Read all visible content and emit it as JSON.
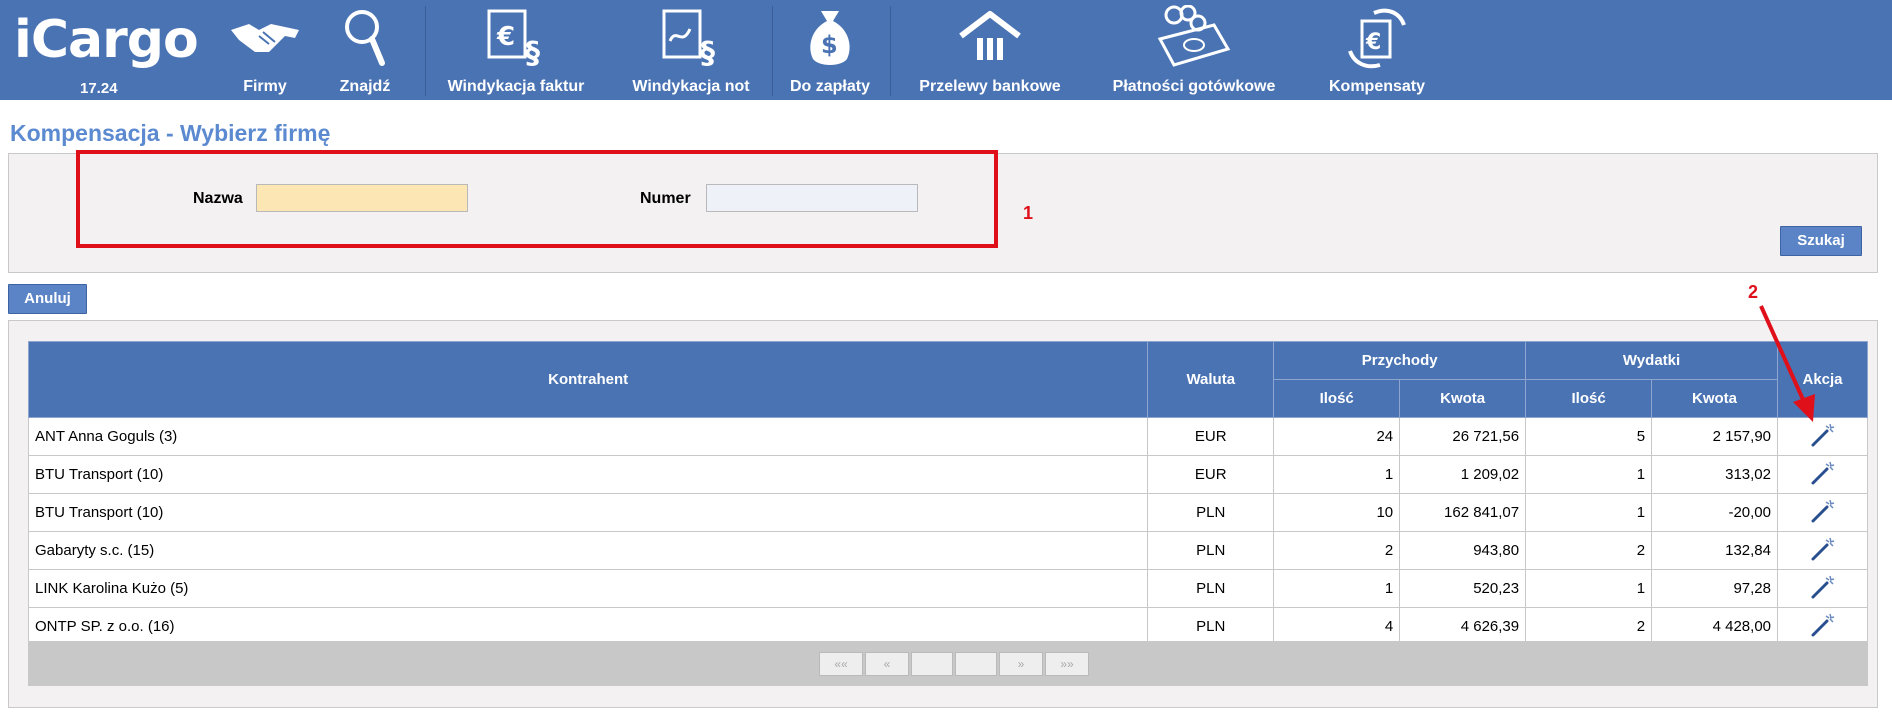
{
  "app": {
    "logo_text": "iCargo",
    "version": "17.24"
  },
  "nav": [
    {
      "label": "Firmy",
      "icon": "handshake-icon"
    },
    {
      "label": "Znajdź",
      "icon": "magnifier-icon"
    },
    {
      "label": "Windykacja faktur",
      "icon": "invoice-euro-icon"
    },
    {
      "label": "Windykacja not",
      "icon": "note-signature-icon"
    },
    {
      "label": "Do zapłaty",
      "icon": "money-bag-icon"
    },
    {
      "label": "Przelewy bankowe",
      "icon": "bank-icon"
    },
    {
      "label": "Płatności gotówkowe",
      "icon": "cash-coins-icon"
    },
    {
      "label": "Kompensaty",
      "icon": "compensation-euro-icon"
    }
  ],
  "page": {
    "title": "Kompensacja - Wybierz firmę"
  },
  "search": {
    "name_label": "Nazwa",
    "name_value": "",
    "number_label": "Numer",
    "number_value": "",
    "search_button": "Szukaj"
  },
  "annotations": {
    "first": "1",
    "second": "2"
  },
  "cancel_button": "Anuluj",
  "table": {
    "headers": {
      "contractor": "Kontrahent",
      "currency": "Waluta",
      "income": "Przychody",
      "expenses": "Wydatki",
      "count": "Ilość",
      "amount": "Kwota",
      "action": "Akcja"
    },
    "rows": [
      {
        "contractor": "ANT Anna Goguls (3)",
        "currency": "EUR",
        "income_count": "24",
        "income_amount": "26 721,56",
        "expense_count": "5",
        "expense_amount": "2 157,90"
      },
      {
        "contractor": "BTU Transport (10)",
        "currency": "EUR",
        "income_count": "1",
        "income_amount": "1 209,02",
        "expense_count": "1",
        "expense_amount": "313,02"
      },
      {
        "contractor": "BTU Transport (10)",
        "currency": "PLN",
        "income_count": "10",
        "income_amount": "162 841,07",
        "expense_count": "1",
        "expense_amount": "-20,00"
      },
      {
        "contractor": "Gabaryty s.c. (15)",
        "currency": "PLN",
        "income_count": "2",
        "income_amount": "943,80",
        "expense_count": "2",
        "expense_amount": "132,84"
      },
      {
        "contractor": "LINK Karolina Kużo (5)",
        "currency": "PLN",
        "income_count": "1",
        "income_amount": "520,23",
        "expense_count": "1",
        "expense_amount": "97,28"
      },
      {
        "contractor": "ONTP SP. z o.o. (16)",
        "currency": "PLN",
        "income_count": "4",
        "income_amount": "4 626,39",
        "expense_count": "2",
        "expense_amount": "4 428,00"
      }
    ]
  },
  "pager": {
    "first": "««",
    "prev": "«",
    "next": "»",
    "last": "»»"
  },
  "colors": {
    "nav_bg": "#4a73b3",
    "title": "#5b8ad0",
    "highlight": "#e0101b",
    "name_field": "#fce6b3",
    "number_field": "#eef2f8"
  }
}
